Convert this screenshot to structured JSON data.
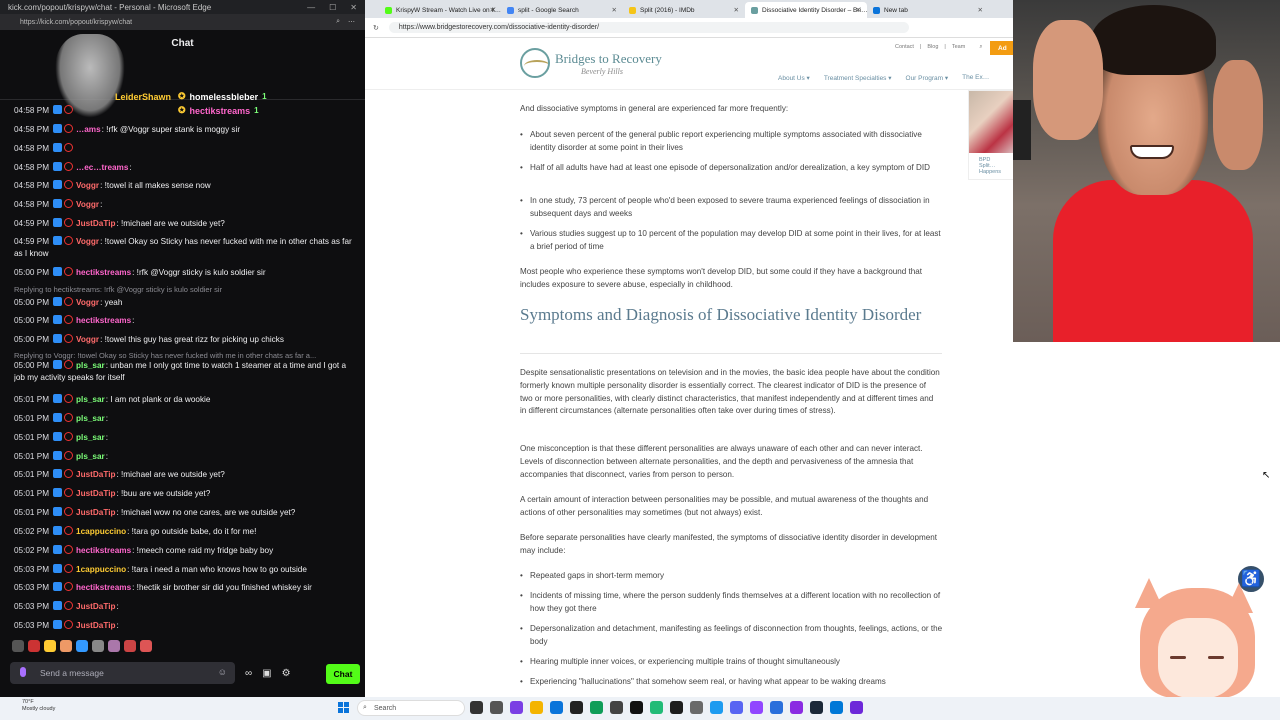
{
  "chat_window": {
    "title": "kick.com/popout/krispyw/chat - Personal - Microsoft Edge",
    "url": "https://kick.com/popout/krispyw/chat",
    "heading": "Chat",
    "leaders": [
      {
        "name": "LeiderShawn",
        "count": "1"
      },
      {
        "name": "homelessbleber",
        "count": "1"
      },
      {
        "name": "hectikstreams",
        "count": "1"
      }
    ],
    "messages": [
      {
        "time": "04:58 PM",
        "user": "",
        "text": "",
        "color": "#ffffff"
      },
      {
        "time": "04:58 PM",
        "user": "…ams",
        "text": ": !rfk @Voggr super stank is moggy sir",
        "color": "#ff66cc"
      },
      {
        "time": "04:58 PM",
        "user": "",
        "text": "",
        "color": "#ffffff"
      },
      {
        "time": "04:58 PM",
        "user": "…ec…treams",
        "text": ":",
        "color": "#ff66cc"
      },
      {
        "time": "04:58 PM",
        "user": "Voggr",
        "text": ": !towel it all makes sense now",
        "color": "#ff6b6b"
      },
      {
        "time": "04:58 PM",
        "user": "Voggr",
        "text": ":",
        "color": "#ff6b6b"
      },
      {
        "time": "04:59 PM",
        "user": "JustDaTip",
        "text": ": !michael are we outside yet?",
        "color": "#ff6b6b"
      },
      {
        "time": "04:59 PM",
        "user": "Voggr",
        "text": ": !towel Okay so Sticky has never fucked with me in other chats as far as I know",
        "color": "#ff6b6b"
      },
      {
        "time": "05:00 PM",
        "user": "hectikstreams",
        "text": ": !rfk @Voggr sticky is kulo soldier sir",
        "color": "#ff66cc"
      },
      {
        "time": "05:00 PM",
        "user": "Voggr",
        "text": ": yeah",
        "color": "#ff6b6b"
      },
      {
        "time": "05:00 PM",
        "user": "hectikstreams",
        "text": ":",
        "color": "#ff66cc"
      },
      {
        "time": "05:00 PM",
        "user": "Voggr",
        "text": ": !towel this guy has great rizz for picking up chicks",
        "color": "#ff6b6b"
      },
      {
        "time": "05:00 PM",
        "user": "pls_sar",
        "text": ": unban me I only got time to watch 1 steamer at a time and I got a job my activity speaks for itself",
        "color": "#7cff79"
      },
      {
        "time": "05:01 PM",
        "user": "pls_sar",
        "text": ": I am not plank or da wookie",
        "color": "#7cff79"
      },
      {
        "time": "05:01 PM",
        "user": "pls_sar",
        "text": ":",
        "color": "#7cff79"
      },
      {
        "time": "05:01 PM",
        "user": "pls_sar",
        "text": ":",
        "color": "#7cff79"
      },
      {
        "time": "05:01 PM",
        "user": "pls_sar",
        "text": ":",
        "color": "#7cff79"
      },
      {
        "time": "05:01 PM",
        "user": "JustDaTip",
        "text": ": !michael are we outside yet?",
        "color": "#ff6b6b"
      },
      {
        "time": "05:01 PM",
        "user": "JustDaTip",
        "text": ": !buu are we outside yet?",
        "color": "#ff6b6b"
      },
      {
        "time": "05:01 PM",
        "user": "JustDaTip",
        "text": ": !michael wow no one cares, are we outside yet?",
        "color": "#ff6b6b"
      },
      {
        "time": "05:02 PM",
        "user": "1cappuccino",
        "text": ": !tara go outside babe, do it for me!",
        "color": "#ffcc33"
      },
      {
        "time": "05:02 PM",
        "user": "hectikstreams",
        "text": ": !meech come raid my fridge baby boy",
        "color": "#ff66cc"
      },
      {
        "time": "05:03 PM",
        "user": "1cappuccino",
        "text": ": !tara i need a man who knows how to go outside",
        "color": "#ffcc33"
      },
      {
        "time": "05:03 PM",
        "user": "hectikstreams",
        "text": ": !hectik sir brother sir did you finished whiskey sir",
        "color": "#ff66cc"
      },
      {
        "time": "05:03 PM",
        "user": "JustDaTip",
        "text": ":",
        "color": "#ff6b6b"
      },
      {
        "time": "05:03 PM",
        "user": "JustDaTip",
        "text": ":",
        "color": "#ff6b6b"
      }
    ],
    "replies": [
      "Replying to hectikstreams: !rfk @Voggr sticky is kulo soldier sir",
      "Replying to Voggr: !towel Okay so Sticky has never fucked with me in other chats as far a..."
    ],
    "input_placeholder": "Send a message",
    "chat_button": "Chat"
  },
  "browser": {
    "tabs": [
      {
        "label": "KrispyW Stream - Watch Live on K…",
        "color": "#53fc18"
      },
      {
        "label": "split - Google Search",
        "color": "#4285f4"
      },
      {
        "label": "Split (2016) - IMDb",
        "color": "#f5c518"
      },
      {
        "label": "Dissociative Identity Disorder – Bri…",
        "color": "#6a9fa0"
      },
      {
        "label": "New tab",
        "color": "#0a74da"
      }
    ],
    "url": "https://www.bridgestorecovery.com/dissociative-identity-disorder/",
    "site": {
      "logo_line1": "Bridges to Recovery",
      "logo_line2": "Beverly Hills",
      "toplinks": [
        "Contact",
        "Blog",
        "Team"
      ],
      "add_label": "Ad",
      "nav": [
        "About Us ▾",
        "Treatment Specialties ▾",
        "Our Program ▾",
        "The Ex…"
      ],
      "intro": "And dissociative symptoms in general are experienced far more frequently:",
      "bullets1": [
        "About seven percent of the general public report experiencing multiple symptoms associated with dissociative identity disorder at some point in their lives",
        "Half of all adults have had at least one episode of depersonalization and/or derealization, a key symptom of DID",
        "In one study, 73 percent of people who'd been exposed to severe trauma experienced feelings of dissociation in subsequent days and weeks",
        "Various studies suggest up to 10 percent of the population may develop DID at some point in their lives, for at least a brief period of time"
      ],
      "para1": "Most people who experience these symptoms won't develop DID, but some could if they have a background that includes exposure to severe abuse, especially in childhood.",
      "heading": "Symptoms and Diagnosis of Dissociative Identity Disorder",
      "para2": "Despite sensationalistic presentations on television and in the movies, the basic idea people have about the condition formerly known multiple personality disorder is essentially correct. The clearest indicator of DID is the presence of two or more personalities, with clearly distinct characteristics, that manifest independently and at different times and in different circumstances (alternate personalities often take over during times of stress).",
      "para3": "One misconception is that these different personalities are always unaware of each other and can never interact. Levels of disconnection between alternate personalities, and the depth and pervasiveness of the amnesia that accompanies that disconnect, varies from person to person.",
      "para4": "A certain amount of interaction between personalities may be possible, and mutual awareness of the thoughts and actions of other personalities may sometimes (but not always) exist.",
      "para5": "Before separate personalities have clearly manifested, the symptoms of dissociative identity disorder in development may include:",
      "bullets2": [
        "Repeated gaps in short-term memory",
        "Incidents of missing time, where the person suddenly finds themselves at a different location with no recollection of how they got there",
        "Depersonalization and detachment, manifesting as feelings of disconnection from thoughts, feelings, actions, or the body",
        "Hearing multiple inner voices, or experiencing multiple trains of thought simultaneously",
        "Experiencing \"hallucinations\" that somehow seem real, or having what appear to be waking dreams"
      ],
      "side_caption": "BPD Split… Happens"
    }
  },
  "taskbar": {
    "weather_temp": "70°F",
    "weather_desc": "Mostly cloudy",
    "search_label": "Search"
  }
}
